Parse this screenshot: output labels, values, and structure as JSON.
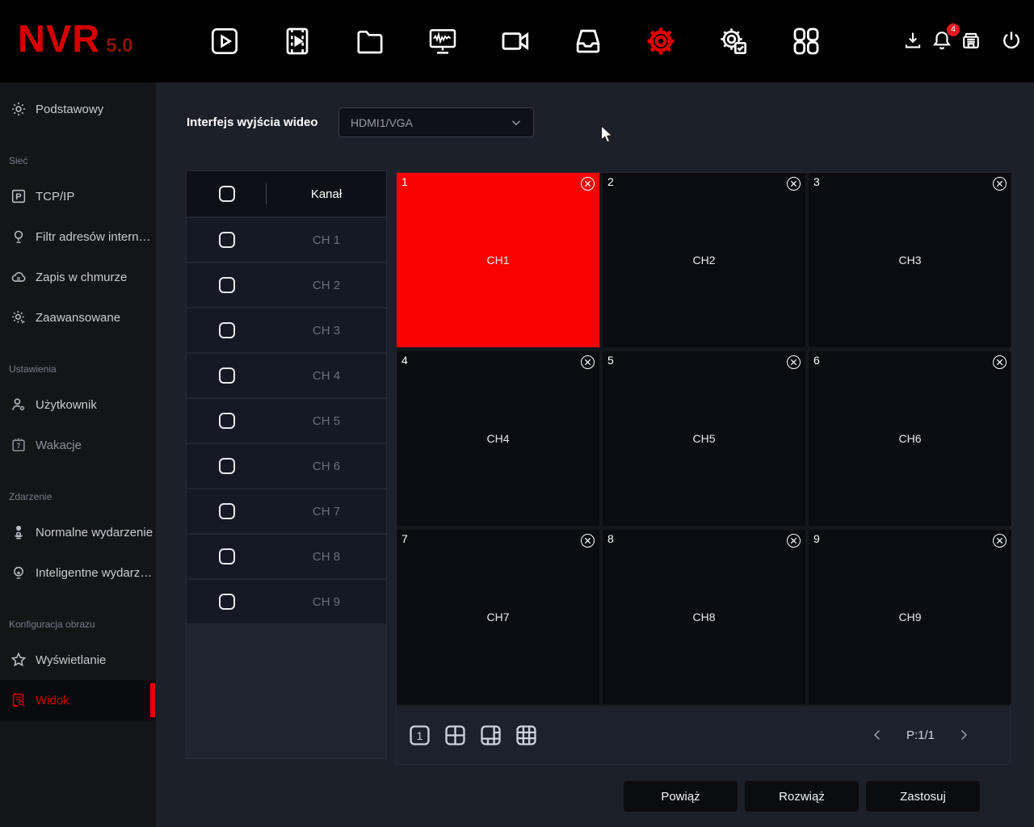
{
  "app": {
    "logo_text": "NVR",
    "logo_version": "5.0"
  },
  "topbar": {
    "nav_icons": [
      "preview-icon",
      "playback-icon",
      "file-management-icon",
      "display-monitor-icon",
      "camera-icon",
      "storage-icon",
      "system-settings-icon",
      "maintenance-icon",
      "apps-icon"
    ],
    "active_nav": "system-settings-icon",
    "status_icons": [
      "export-icon",
      "alarm-bell-icon",
      "device-inbox-icon",
      "power-icon"
    ],
    "alarm_badge": "4"
  },
  "sidebar": {
    "items": [
      {
        "type": "item",
        "label": "Podstawowy",
        "icon": "gear-icon"
      },
      {
        "type": "section",
        "label": "Sieć"
      },
      {
        "type": "item",
        "label": "TCP/IP",
        "icon": "tcpip-icon"
      },
      {
        "type": "item",
        "label": "Filtr adresów internet...",
        "icon": "address-filter-icon"
      },
      {
        "type": "item",
        "label": "Zapis w chmurze",
        "icon": "cloud-icon"
      },
      {
        "type": "item",
        "label": "Zaawansowane",
        "icon": "advanced-gear-icon"
      },
      {
        "type": "section",
        "label": "Ustawienia"
      },
      {
        "type": "item",
        "label": "Użytkownik",
        "icon": "user-gear-icon"
      },
      {
        "type": "item",
        "label": "Wakacje",
        "icon": "calendar-icon",
        "muted": true
      },
      {
        "type": "section",
        "label": "Zdarzenie"
      },
      {
        "type": "item",
        "label": "Normalne wydarzenie",
        "icon": "person-icon"
      },
      {
        "type": "item",
        "label": "Inteligentne wydarzenie",
        "icon": "smart-event-icon"
      },
      {
        "type": "section",
        "label": "Konfiguracja obrazu"
      },
      {
        "type": "item",
        "label": "Wyświetlanie",
        "icon": "star-icon"
      },
      {
        "type": "item",
        "label": "Widok",
        "icon": "view-document-icon",
        "active": true
      }
    ]
  },
  "main": {
    "output_interface_label": "Interfejs wyjścia wideo",
    "output_interface_value": "HDMI1/VGA",
    "channel_table": {
      "header": "Kanał",
      "rows": [
        "CH 1",
        "CH 2",
        "CH 3",
        "CH 4",
        "CH 5",
        "CH 6",
        "CH 7",
        "CH 8",
        "CH 9"
      ]
    },
    "grid": {
      "cells": [
        {
          "num": "1",
          "label": "CH1",
          "highlight": true
        },
        {
          "num": "2",
          "label": "CH2"
        },
        {
          "num": "3",
          "label": "CH3"
        },
        {
          "num": "4",
          "label": "CH4"
        },
        {
          "num": "5",
          "label": "CH5"
        },
        {
          "num": "6",
          "label": "CH6"
        },
        {
          "num": "7",
          "label": "CH7"
        },
        {
          "num": "8",
          "label": "CH8"
        },
        {
          "num": "9",
          "label": "CH9"
        }
      ],
      "layout_icons": [
        "layout-1-icon",
        "layout-4-icon",
        "layout-6-icon",
        "layout-9-icon"
      ],
      "pager_label": "P:1/1"
    },
    "actions": {
      "bind": "Powiąż",
      "unbind": "Rozwiąż",
      "apply": "Zastosuj"
    }
  },
  "colors": {
    "accent_red": "#d40000",
    "cell_highlight_red": "#f90202",
    "badge_red": "#e01b24"
  }
}
